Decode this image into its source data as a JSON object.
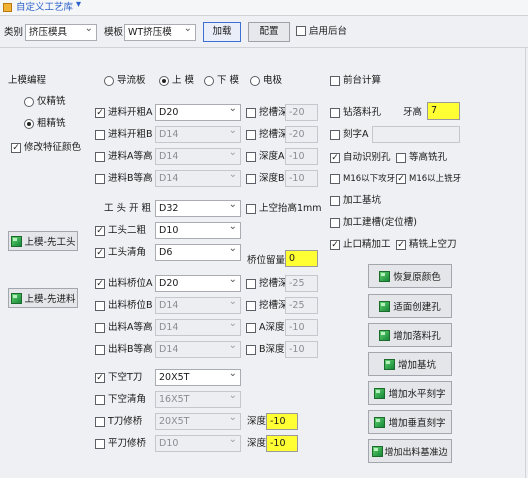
{
  "title": "自定义工艺库",
  "toolbar": {
    "category_label": "类别",
    "category_value": "挤压模具",
    "template_label": "模板",
    "template_value": "WT挤压模",
    "load_button": "加载",
    "config_button": "配置",
    "enable_backend_label": "启用后台"
  },
  "left": {
    "section_title": "上模编程",
    "radio_finish_only": "仅精铣",
    "radio_rough_finish": "粗精铣",
    "modify_feature_color": "修改特征颜色",
    "btn_head_first": "上模-先工头",
    "btn_feed_first": "上模-先进料"
  },
  "mode_radios": [
    "导流板",
    "上 模",
    "下 模",
    "电极"
  ],
  "rows": [
    {
      "label": "进料开粗A",
      "value": "D20",
      "sub_label": "挖槽深",
      "sub_value": "-20"
    },
    {
      "label": "进料开粗B",
      "value": "D14",
      "sub_label": "挖槽深",
      "sub_value": "-20"
    },
    {
      "label": "进料A等高",
      "value": "D14",
      "sub_label": "深度A",
      "sub_value": "-10"
    },
    {
      "label": "进料B等高",
      "value": "D14",
      "sub_label": "深度B",
      "sub_value": "-10"
    }
  ],
  "head": {
    "rough_label": "工 头 开 粗",
    "rough_value": "D32",
    "raise_label": "上空抬高1mm",
    "second_rough_label": "工头二粗",
    "second_rough_value": "D10",
    "chamfer_label": "工头清角",
    "chamfer_value": "D6",
    "bridge_allowance_label": "桥位留量",
    "bridge_allowance_value": "0"
  },
  "out_rows": [
    {
      "label": "出料桥位A",
      "value": "D20",
      "sub_label": "挖槽深",
      "sub_value": "-25"
    },
    {
      "label": "出料桥位B",
      "value": "D14",
      "sub_label": "挖槽深",
      "sub_value": "-25"
    },
    {
      "label": "出料A等高",
      "value": "D14",
      "sub_label": "A深度",
      "sub_value": "-10"
    },
    {
      "label": "出料B等高",
      "value": "D14",
      "sub_label": "B深度",
      "sub_value": "-10"
    }
  ],
  "tools": [
    {
      "label": "下空T刀",
      "value": "20X5T"
    },
    {
      "label": "下空清角",
      "value": "16X5T"
    },
    {
      "label": "T刀修桥",
      "value": "20X5T",
      "sub_label": "深度",
      "sub_value": "-10"
    },
    {
      "label": "平刀修桥",
      "value": "D10",
      "sub_label": "深度",
      "sub_value": "-10"
    }
  ],
  "right": {
    "front_calc": "前台计算",
    "drill_hole": "钻落料孔",
    "tooth_height_label": "牙高",
    "tooth_height_value": "7",
    "engrave_a": "刻字A",
    "auto_detect_hole": "自动识别孔",
    "equal_height_hole": "等高铣孔",
    "m16_below": "M16以下攻牙",
    "m16_above": "M16以上铣牙",
    "machining_pit": "加工基坑",
    "machining_bridge": "加工建槽(定位槽)",
    "stop_machining": "止口精加工",
    "finish_upper_knife": "精铣上空刀"
  },
  "action_buttons": [
    "恢复原颜色",
    "适面创建孔",
    "增加落料孔",
    "增加基坑",
    "增加水平刻字",
    "增加垂直刻字",
    "增加出料基准边"
  ],
  "colors": {
    "highlight_yellow": "#ffff33",
    "accent_blue": "#3c6fd6",
    "green_icon": "#2fa84a"
  }
}
